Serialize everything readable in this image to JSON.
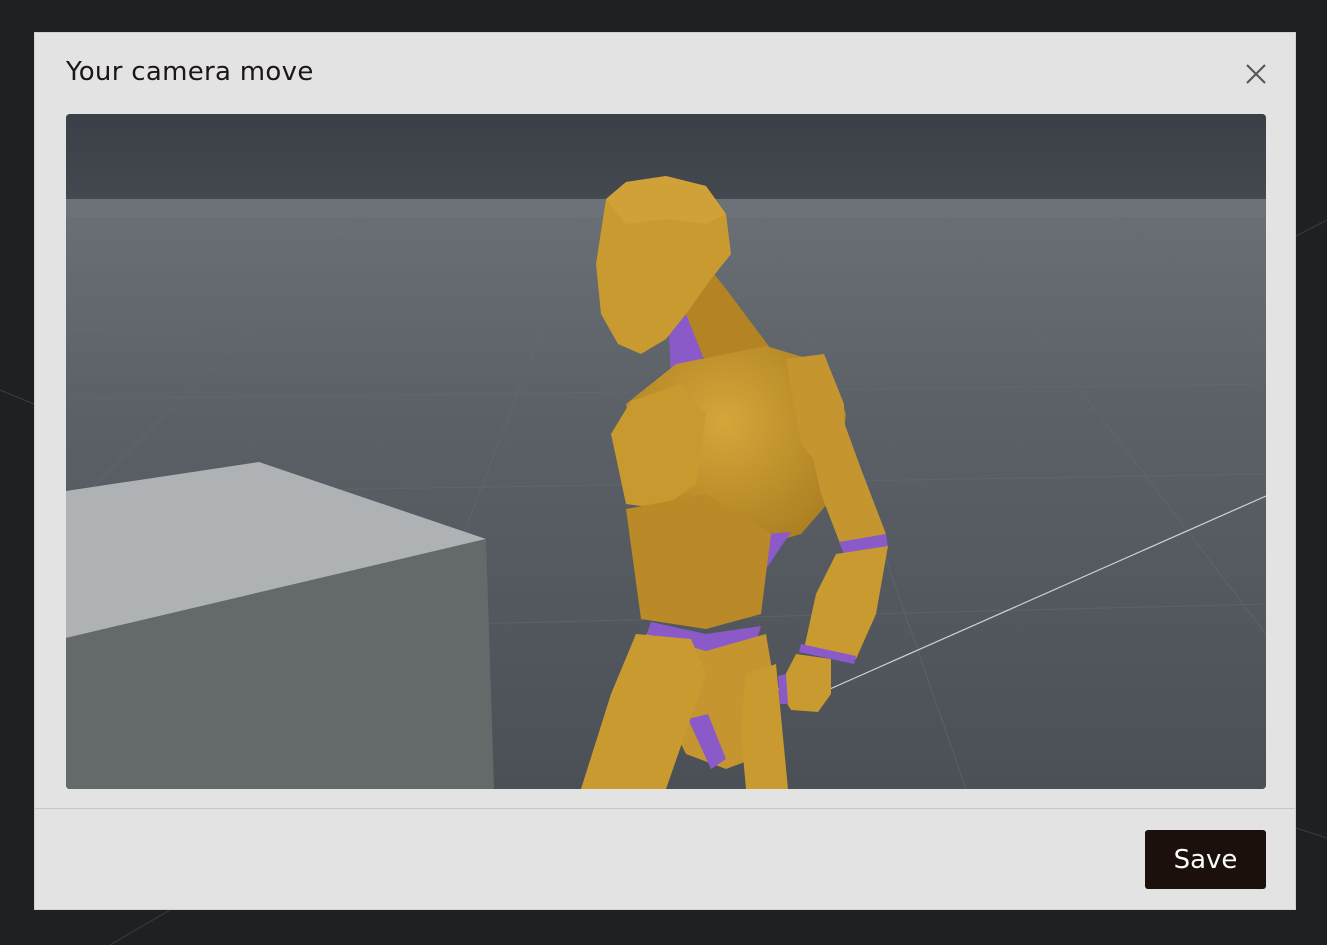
{
  "dialog": {
    "title": "Your camera move",
    "close_icon": "close-icon",
    "save_label": "Save"
  },
  "viewport": {
    "scene": "3d-mannequin-preview",
    "colors": {
      "sky": "#3e424a",
      "floor": "#5a6066",
      "box_top": "#aeb2b5",
      "box_side": "#646a6a",
      "figure": "#c89a32",
      "joint": "#8a5ac8"
    }
  },
  "colors": {
    "dialog_bg": "#e3e3e3",
    "page_bg": "#1f2022",
    "primary_button": "#1c100c"
  }
}
